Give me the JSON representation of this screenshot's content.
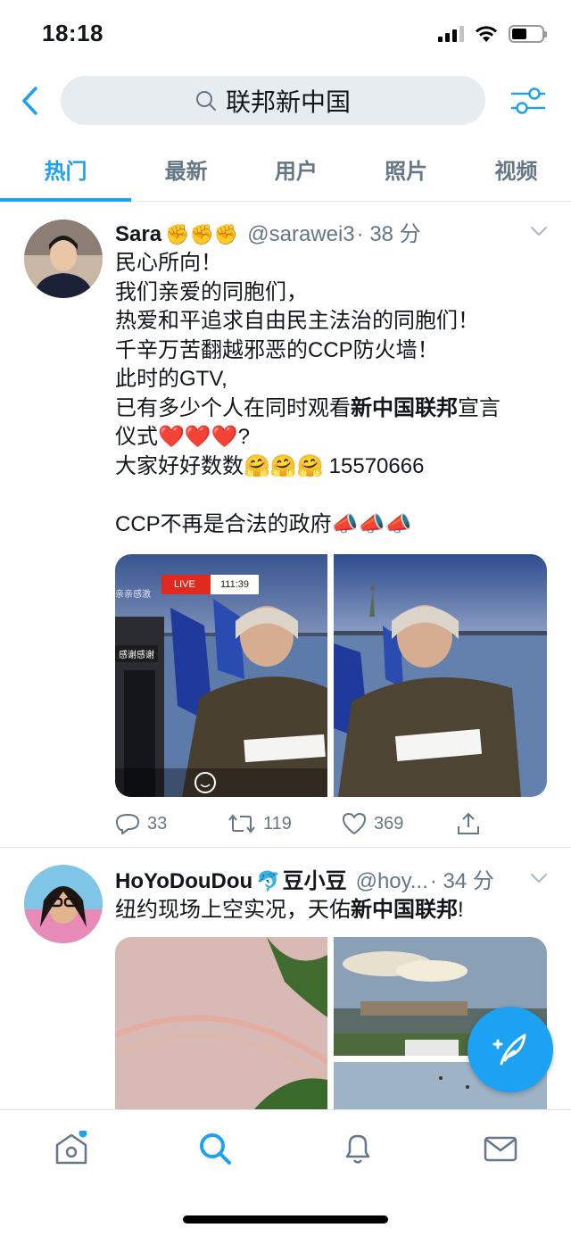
{
  "status": {
    "time": "18:18"
  },
  "search": {
    "query": "联邦新中国"
  },
  "tabs": [
    {
      "label": "热门",
      "active": true
    },
    {
      "label": "最新"
    },
    {
      "label": "用户"
    },
    {
      "label": "照片"
    },
    {
      "label": "视频"
    }
  ],
  "tweets": [
    {
      "name": "Sara",
      "name_emoji": "✊✊✊",
      "handle": "@sarawei3",
      "time": "· 38 分",
      "lines": [
        "民心所向！",
        "我们亲爱的同胞们，",
        "热爱和平追求自由民主法治的同胞们！",
        "千辛万苦翻越邪恶的CCP防火墙！",
        "此时的GTV,"
      ],
      "line6_pre": "已有多少个人在同时观看",
      "line6_bold": "新中国联邦",
      "line6_post": "宣言",
      "line7_pre": "仪式",
      "line7_emoji": "❤️❤️❤️",
      "line7_post": "?",
      "line8_pre": "大家好好数数",
      "line8_emoji": "🤗🤗🤗",
      "line8_post": "15570666",
      "line9_pre": "CCP不再是合法的政府",
      "line9_emoji": "📣📣📣",
      "video_overlay": {
        "live": "LIVE",
        "timer": "111:39",
        "caption_top": "亲亲感激",
        "caption_bottom": "感谢感谢"
      },
      "replies": "33",
      "retweets": "119",
      "likes": "369"
    },
    {
      "name": "HoYoDouDou",
      "name_emoji": "🐬",
      "name_suffix": "豆小豆",
      "handle": "@hoy...",
      "time": "· 34 分",
      "text_pre": "纽约现场上空实况，天佑",
      "text_bold": "新中国联邦",
      "text_post": "!"
    }
  ],
  "colors": {
    "accent": "#1da1f2",
    "secondary_text": "#657786",
    "search_bg": "#e6ecf0",
    "divider": "#e1e8ed"
  }
}
